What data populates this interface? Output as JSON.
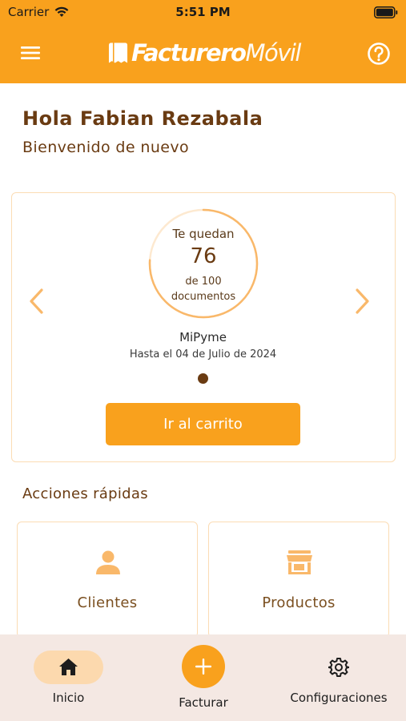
{
  "status_bar": {
    "carrier": "Carrier",
    "time": "5:51 PM"
  },
  "header": {
    "brand_primary": "Facturero",
    "brand_secondary": "Móvil",
    "menu_icon": "hamburger-menu-icon",
    "help_icon": "help-circle-icon"
  },
  "greeting": {
    "title": "Hola Fabian Rezabala",
    "subtitle": "Bienvenido de nuevo"
  },
  "plan": {
    "remaining_label": "Te quedan",
    "remaining": "76",
    "total_label": "de 100",
    "unit_label": "documentos",
    "remaining_fraction": 0.76,
    "name": "MiPyme",
    "valid_until": "Hasta el 04 de Julio de 2024",
    "cart_button": "Ir al carrito",
    "prev_icon": "chevron-left-icon",
    "next_icon": "chevron-right-icon"
  },
  "quick_actions": {
    "title": "Acciones rápidas",
    "items": [
      {
        "label": "Clientes",
        "icon": "person-icon"
      },
      {
        "label": "Productos",
        "icon": "store-icon"
      }
    ]
  },
  "bottom_nav": {
    "items": [
      {
        "label": "Inicio",
        "icon": "home-icon",
        "active": true
      },
      {
        "label": "Facturar",
        "icon": "plus-icon"
      },
      {
        "label": "Configuraciones",
        "icon": "gear-icon"
      }
    ]
  },
  "colors": {
    "primary": "#f9a11d",
    "text_brown": "#6a3b12",
    "card_border": "#fbdcb4",
    "nav_background": "#f4e8e3",
    "active_pill": "#fcd9ae"
  }
}
